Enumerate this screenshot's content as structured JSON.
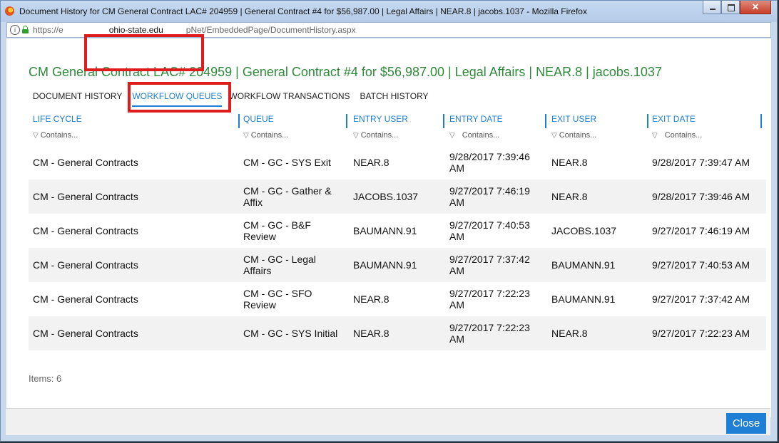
{
  "window": {
    "title": "Document History for CM General Contract LAC# 204959 | General Contract #4 for $56,987.00 | Legal Affairs | NEAR.8 | jacobs.1037 - Mozilla Firefox",
    "url_left": "https://e",
    "url_domain": "ohio-state.edu",
    "url_path": "pNet/EmbeddedPage/DocumentHistory.aspx"
  },
  "page": {
    "title": "CM General Contract LAC# 204959 | General Contract #4 for $56,987.00 | Legal Affairs | NEAR.8 | jacobs.1037",
    "tabs": [
      {
        "label": "DOCUMENT HISTORY",
        "active": false
      },
      {
        "label": "WORKFLOW QUEUES",
        "active": true
      },
      {
        "label": "WORKFLOW TRANSACTIONS",
        "active": false
      },
      {
        "label": "BATCH HISTORY",
        "active": false
      }
    ]
  },
  "grid": {
    "columns": [
      "LIFE CYCLE",
      "QUEUE",
      "ENTRY USER",
      "ENTRY DATE",
      "EXIT USER",
      "EXIT DATE"
    ],
    "filter_placeholder": "Contains...",
    "rows": [
      [
        "CM - General Contracts",
        "CM - GC - SYS Exit",
        "NEAR.8",
        "9/28/2017 7:39:46 AM",
        "NEAR.8",
        "9/28/2017 7:39:47 AM"
      ],
      [
        "CM - General Contracts",
        "CM - GC - Gather & Affix",
        "JACOBS.1037",
        "9/27/2017 7:46:19 AM",
        "NEAR.8",
        "9/28/2017 7:39:46 AM"
      ],
      [
        "CM - General Contracts",
        "CM - GC - B&F Review",
        "BAUMANN.91",
        "9/27/2017 7:40:53 AM",
        "JACOBS.1037",
        "9/27/2017 7:46:19 AM"
      ],
      [
        "CM - General Contracts",
        "CM - GC - Legal Affairs",
        "BAUMANN.91",
        "9/27/2017 7:37:42 AM",
        "BAUMANN.91",
        "9/27/2017 7:40:53 AM"
      ],
      [
        "CM - General Contracts",
        "CM - GC - SFO Review",
        "NEAR.8",
        "9/27/2017 7:22:23 AM",
        "BAUMANN.91",
        "9/27/2017 7:37:42 AM"
      ],
      [
        "CM - General Contracts",
        "CM - GC - SYS Initial",
        "NEAR.8",
        "9/27/2017 7:22:23 AM",
        "NEAR.8",
        "9/27/2017 7:22:23 AM"
      ]
    ],
    "items_count": "Items: 6"
  },
  "footer": {
    "close_label": "Close"
  },
  "colors": {
    "accent": "#1f7fd4",
    "title_green": "#2e8b3a",
    "highlight_red": "#e01b1b"
  }
}
